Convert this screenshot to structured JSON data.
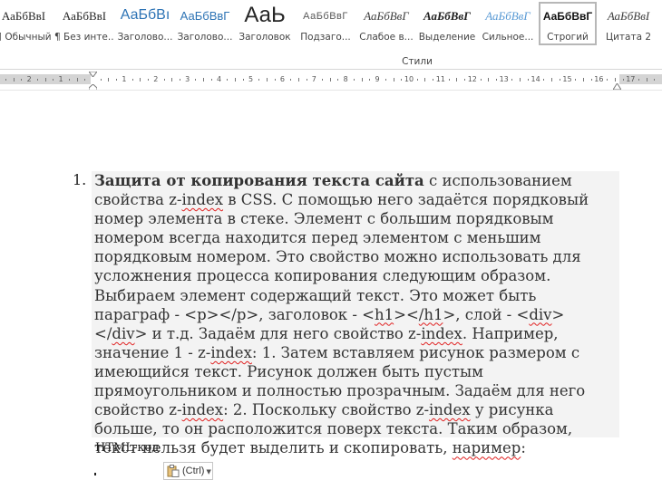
{
  "styles_gallery": {
    "group_label": "Стили",
    "items": [
      {
        "sample": "АаБбВвI",
        "label": "¶ Обычный"
      },
      {
        "sample": "АаБбВвI",
        "label": "¶ Без инте..."
      },
      {
        "sample": "АаБбВı",
        "label": "Заголово..."
      },
      {
        "sample": "АаБбВвГ",
        "label": "Заголово..."
      },
      {
        "sample": "АаЬ",
        "label": "Заголовок"
      },
      {
        "sample": "АаБбВвГ",
        "label": "Подзаго..."
      },
      {
        "sample": "АаБбВвГ",
        "label": "Слабое в..."
      },
      {
        "sample": "АаБбВвГ",
        "label": "Выделение"
      },
      {
        "sample": "АаБбВвГ",
        "label": "Сильное..."
      },
      {
        "sample": "АаБбВвГ",
        "label": "Строгий",
        "selected": true
      },
      {
        "sample": "АаБбВвI",
        "label": "Цитата 2"
      }
    ]
  },
  "ruler": {
    "left_numbers": [
      "2",
      "1"
    ],
    "numbers": [
      "1",
      "2",
      "3",
      "4",
      "5",
      "6",
      "7",
      "8",
      "9",
      "10",
      "11",
      "12",
      "13",
      "14",
      "15",
      "16",
      "17"
    ]
  },
  "document": {
    "list_number": "1.",
    "paragraph": {
      "bold_lead": "Защита от копирования текста сайта",
      "seg1": " с использованием свойства z-",
      "sq1": "index",
      "seg2": " в CSS. С помощью него задаётся порядковый номер элемента в стеке. Элемент с большим порядковым номером всегда находится перед элементом с меньшим порядковым номером. Это свойство можно использовать для усложнения процесса копирования следующим образом. Выбираем элемент содержащий текст. Это может быть параграф - <p></p>, заголовок - <",
      "sq2": "h1",
      "seg3": "><",
      "sq3": "/h1",
      "seg4": ">, слой - <",
      "sq4": "div",
      "seg5": "></",
      "sq5": "div",
      "seg6": "> и т.д. Задаём для него свойство z-",
      "sq6": "index",
      "seg7": ". Например, значение 1 - z-",
      "sq7": "index",
      "seg8": ": 1. Затем вставляем рисунок размером с имеющийся текст. Рисунок должен быть пустым прямоугольником и полностью прозрачным. Задаём для него свойство z-",
      "sq8": "index",
      "seg9": ": 2. Поскольку свойство z-",
      "sq9": "index",
      "seg10": " у рисунка больше, то он расположится поверх текста. Таким образом, текст нельзя будет выделить и скопировать, ",
      "sq10": "наример",
      "seg11": ":"
    },
    "html_code_label": "HTML-код"
  },
  "paste_options": {
    "label": "(Ctrl)",
    "icon": "clipboard-paste-icon"
  }
}
